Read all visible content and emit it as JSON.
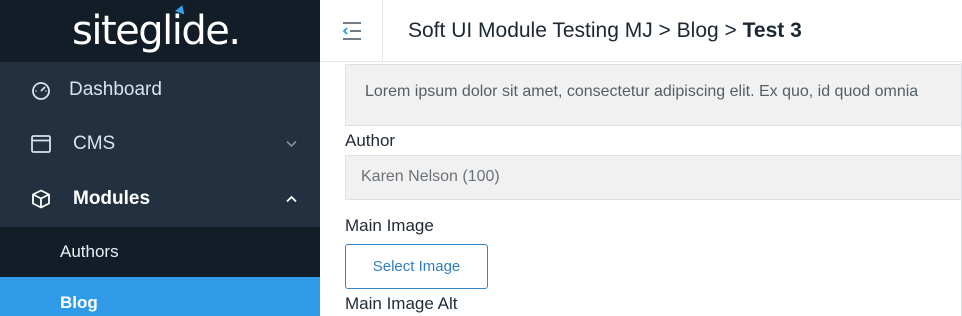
{
  "sidebar": {
    "logo": "siteglide.",
    "items": [
      {
        "label": "Dashboard",
        "icon": "gauge-icon"
      },
      {
        "label": "CMS",
        "icon": "window-icon",
        "chevron": "chevron-down-icon"
      },
      {
        "label": "Modules",
        "icon": "cube-icon",
        "chevron": "chevron-up-icon"
      }
    ],
    "subitems": [
      {
        "label": "Authors"
      },
      {
        "label": "Blog",
        "active": true
      }
    ]
  },
  "header": {
    "toggle_icon": "menu-collapse-icon",
    "breadcrumb": {
      "path": "Soft UI Module Testing MJ > Blog > ",
      "current": "Test 3"
    }
  },
  "form": {
    "description_value": "Lorem ipsum dolor sit amet, consectetur adipiscing elit. Ex quo, id quod omnia",
    "author_label": "Author",
    "author_value": "Karen Nelson (100)",
    "main_image_label": "Main Image",
    "select_image_button": "Select Image",
    "main_image_alt_label": "Main Image Alt"
  },
  "colors": {
    "sidebar_bg": "#22303f",
    "sidebar_dark": "#131d27",
    "active_blue": "#2f9be8",
    "button_blue": "#2f7fc6"
  }
}
